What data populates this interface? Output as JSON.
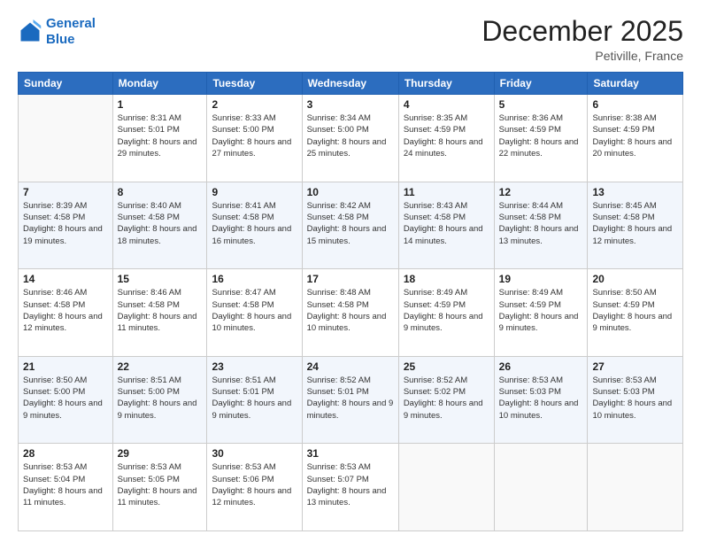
{
  "logo": {
    "line1": "General",
    "line2": "Blue"
  },
  "header": {
    "month": "December 2025",
    "location": "Petiville, France"
  },
  "weekdays": [
    "Sunday",
    "Monday",
    "Tuesday",
    "Wednesday",
    "Thursday",
    "Friday",
    "Saturday"
  ],
  "weeks": [
    [
      {
        "day": "",
        "sunrise": "",
        "sunset": "",
        "daylight": ""
      },
      {
        "day": "1",
        "sunrise": "Sunrise: 8:31 AM",
        "sunset": "Sunset: 5:01 PM",
        "daylight": "Daylight: 8 hours and 29 minutes."
      },
      {
        "day": "2",
        "sunrise": "Sunrise: 8:33 AM",
        "sunset": "Sunset: 5:00 PM",
        "daylight": "Daylight: 8 hours and 27 minutes."
      },
      {
        "day": "3",
        "sunrise": "Sunrise: 8:34 AM",
        "sunset": "Sunset: 5:00 PM",
        "daylight": "Daylight: 8 hours and 25 minutes."
      },
      {
        "day": "4",
        "sunrise": "Sunrise: 8:35 AM",
        "sunset": "Sunset: 4:59 PM",
        "daylight": "Daylight: 8 hours and 24 minutes."
      },
      {
        "day": "5",
        "sunrise": "Sunrise: 8:36 AM",
        "sunset": "Sunset: 4:59 PM",
        "daylight": "Daylight: 8 hours and 22 minutes."
      },
      {
        "day": "6",
        "sunrise": "Sunrise: 8:38 AM",
        "sunset": "Sunset: 4:59 PM",
        "daylight": "Daylight: 8 hours and 20 minutes."
      }
    ],
    [
      {
        "day": "7",
        "sunrise": "Sunrise: 8:39 AM",
        "sunset": "Sunset: 4:58 PM",
        "daylight": "Daylight: 8 hours and 19 minutes."
      },
      {
        "day": "8",
        "sunrise": "Sunrise: 8:40 AM",
        "sunset": "Sunset: 4:58 PM",
        "daylight": "Daylight: 8 hours and 18 minutes."
      },
      {
        "day": "9",
        "sunrise": "Sunrise: 8:41 AM",
        "sunset": "Sunset: 4:58 PM",
        "daylight": "Daylight: 8 hours and 16 minutes."
      },
      {
        "day": "10",
        "sunrise": "Sunrise: 8:42 AM",
        "sunset": "Sunset: 4:58 PM",
        "daylight": "Daylight: 8 hours and 15 minutes."
      },
      {
        "day": "11",
        "sunrise": "Sunrise: 8:43 AM",
        "sunset": "Sunset: 4:58 PM",
        "daylight": "Daylight: 8 hours and 14 minutes."
      },
      {
        "day": "12",
        "sunrise": "Sunrise: 8:44 AM",
        "sunset": "Sunset: 4:58 PM",
        "daylight": "Daylight: 8 hours and 13 minutes."
      },
      {
        "day": "13",
        "sunrise": "Sunrise: 8:45 AM",
        "sunset": "Sunset: 4:58 PM",
        "daylight": "Daylight: 8 hours and 12 minutes."
      }
    ],
    [
      {
        "day": "14",
        "sunrise": "Sunrise: 8:46 AM",
        "sunset": "Sunset: 4:58 PM",
        "daylight": "Daylight: 8 hours and 12 minutes."
      },
      {
        "day": "15",
        "sunrise": "Sunrise: 8:46 AM",
        "sunset": "Sunset: 4:58 PM",
        "daylight": "Daylight: 8 hours and 11 minutes."
      },
      {
        "day": "16",
        "sunrise": "Sunrise: 8:47 AM",
        "sunset": "Sunset: 4:58 PM",
        "daylight": "Daylight: 8 hours and 10 minutes."
      },
      {
        "day": "17",
        "sunrise": "Sunrise: 8:48 AM",
        "sunset": "Sunset: 4:58 PM",
        "daylight": "Daylight: 8 hours and 10 minutes."
      },
      {
        "day": "18",
        "sunrise": "Sunrise: 8:49 AM",
        "sunset": "Sunset: 4:59 PM",
        "daylight": "Daylight: 8 hours and 9 minutes."
      },
      {
        "day": "19",
        "sunrise": "Sunrise: 8:49 AM",
        "sunset": "Sunset: 4:59 PM",
        "daylight": "Daylight: 8 hours and 9 minutes."
      },
      {
        "day": "20",
        "sunrise": "Sunrise: 8:50 AM",
        "sunset": "Sunset: 4:59 PM",
        "daylight": "Daylight: 8 hours and 9 minutes."
      }
    ],
    [
      {
        "day": "21",
        "sunrise": "Sunrise: 8:50 AM",
        "sunset": "Sunset: 5:00 PM",
        "daylight": "Daylight: 8 hours and 9 minutes."
      },
      {
        "day": "22",
        "sunrise": "Sunrise: 8:51 AM",
        "sunset": "Sunset: 5:00 PM",
        "daylight": "Daylight: 8 hours and 9 minutes."
      },
      {
        "day": "23",
        "sunrise": "Sunrise: 8:51 AM",
        "sunset": "Sunset: 5:01 PM",
        "daylight": "Daylight: 8 hours and 9 minutes."
      },
      {
        "day": "24",
        "sunrise": "Sunrise: 8:52 AM",
        "sunset": "Sunset: 5:01 PM",
        "daylight": "Daylight: 8 hours and 9 minutes."
      },
      {
        "day": "25",
        "sunrise": "Sunrise: 8:52 AM",
        "sunset": "Sunset: 5:02 PM",
        "daylight": "Daylight: 8 hours and 9 minutes."
      },
      {
        "day": "26",
        "sunrise": "Sunrise: 8:53 AM",
        "sunset": "Sunset: 5:03 PM",
        "daylight": "Daylight: 8 hours and 10 minutes."
      },
      {
        "day": "27",
        "sunrise": "Sunrise: 8:53 AM",
        "sunset": "Sunset: 5:03 PM",
        "daylight": "Daylight: 8 hours and 10 minutes."
      }
    ],
    [
      {
        "day": "28",
        "sunrise": "Sunrise: 8:53 AM",
        "sunset": "Sunset: 5:04 PM",
        "daylight": "Daylight: 8 hours and 11 minutes."
      },
      {
        "day": "29",
        "sunrise": "Sunrise: 8:53 AM",
        "sunset": "Sunset: 5:05 PM",
        "daylight": "Daylight: 8 hours and 11 minutes."
      },
      {
        "day": "30",
        "sunrise": "Sunrise: 8:53 AM",
        "sunset": "Sunset: 5:06 PM",
        "daylight": "Daylight: 8 hours and 12 minutes."
      },
      {
        "day": "31",
        "sunrise": "Sunrise: 8:53 AM",
        "sunset": "Sunset: 5:07 PM",
        "daylight": "Daylight: 8 hours and 13 minutes."
      },
      {
        "day": "",
        "sunrise": "",
        "sunset": "",
        "daylight": ""
      },
      {
        "day": "",
        "sunrise": "",
        "sunset": "",
        "daylight": ""
      },
      {
        "day": "",
        "sunrise": "",
        "sunset": "",
        "daylight": ""
      }
    ]
  ]
}
